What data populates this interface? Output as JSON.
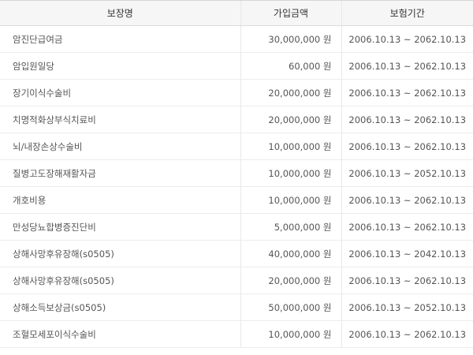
{
  "table": {
    "headers": {
      "name": "보장명",
      "amount": "가입금액",
      "period": "보험기간"
    },
    "rows": [
      {
        "name": "암진단급여금",
        "amount": "30,000,000 원",
        "period": "2006.10.13 ~ 2062.10.13"
      },
      {
        "name": "암입원일당",
        "amount": "60,000 원",
        "period": "2006.10.13 ~ 2062.10.13"
      },
      {
        "name": "장기이식수술비",
        "amount": "20,000,000 원",
        "period": "2006.10.13 ~ 2062.10.13"
      },
      {
        "name": "치명적화상부식치료비",
        "amount": "20,000,000 원",
        "period": "2006.10.13 ~ 2062.10.13"
      },
      {
        "name": "뇌/내장손상수술비",
        "amount": "10,000,000 원",
        "period": "2006.10.13 ~ 2062.10.13"
      },
      {
        "name": "질병고도장해재활자금",
        "amount": "10,000,000 원",
        "period": "2006.10.13 ~ 2052.10.13"
      },
      {
        "name": "개호비용",
        "amount": "10,000,000 원",
        "period": "2006.10.13 ~ 2062.10.13"
      },
      {
        "name": "만성당뇨합병증진단비",
        "amount": "5,000,000 원",
        "period": "2006.10.13 ~ 2062.10.13"
      },
      {
        "name": "상해사망후유장해(s0505)",
        "amount": "40,000,000 원",
        "period": "2006.10.13 ~ 2042.10.13"
      },
      {
        "name": "상해사망후유장해(s0505)",
        "amount": "20,000,000 원",
        "period": "2006.10.13 ~ 2062.10.13"
      },
      {
        "name": "상해소득보상금(s0505)",
        "amount": "50,000,000 원",
        "period": "2006.10.13 ~ 2052.10.13"
      },
      {
        "name": "조혈모세포이식수술비",
        "amount": "10,000,000 원",
        "period": "2006.10.13 ~ 2062.10.13"
      }
    ]
  }
}
